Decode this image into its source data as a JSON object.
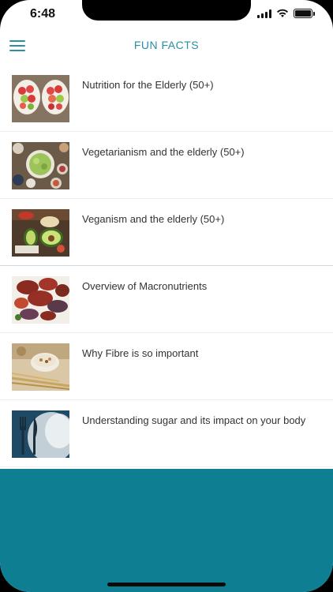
{
  "status": {
    "time": "6:48"
  },
  "header": {
    "title": "FUN FACTS"
  },
  "items": [
    {
      "label": "Nutrition for the Elderly (50+)"
    },
    {
      "label": "Vegetarianism and the elderly (50+)"
    },
    {
      "label": "Veganism and the elderly (50+)"
    },
    {
      "label": "Overview of Macronutrients"
    },
    {
      "label": "Why Fibre is so important"
    },
    {
      "label": "Understanding sugar and its impact on your body"
    }
  ],
  "colors": {
    "accent": "#2a8fa3",
    "footer": "#0e7f93"
  },
  "icons": {
    "menu": "hamburger-menu-icon",
    "signal": "cellular-signal-icon",
    "wifi": "wifi-icon",
    "battery": "battery-icon"
  }
}
